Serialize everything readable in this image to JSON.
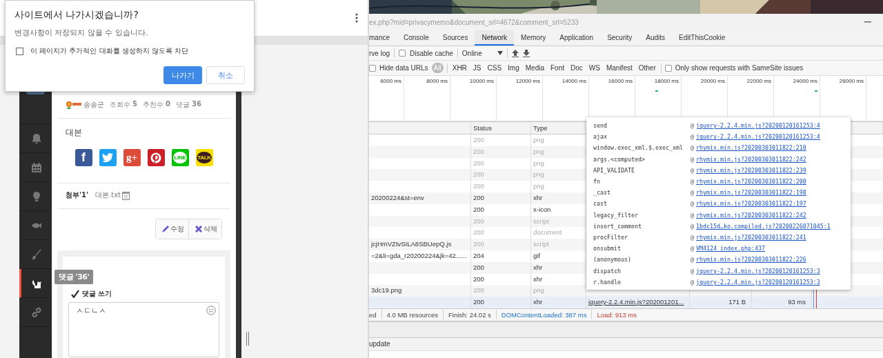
{
  "dialog": {
    "title": "사이트에서 나가시겠습니까?",
    "message": "변경사항이 저장되지 않을 수 있습니다.",
    "checkbox": {
      "label": "이 페이지가 추가적인 대화를 생성하지 않도록 차단",
      "checked": false
    },
    "buttons": [
      {
        "label": "나가기",
        "kind": "primary"
      },
      {
        "label": "취소",
        "kind": "secondary"
      }
    ]
  },
  "sidebar": {
    "items": [
      {
        "kind": "bell",
        "selected": false
      },
      {
        "kind": "calendar",
        "selected": false
      },
      {
        "kind": "bulb",
        "selected": false
      },
      {
        "kind": "fish",
        "selected": false
      },
      {
        "kind": "brush",
        "selected": false
      },
      {
        "kind": "cat",
        "selected": true
      },
      {
        "kind": "link",
        "selected": false
      }
    ],
    "tooltip": "댓글 '36'"
  },
  "post": {
    "author": "송송군",
    "stats": [
      {
        "label": "조회수",
        "value": "5"
      },
      {
        "label": "추천수",
        "value": "0"
      },
      {
        "label": "댓글",
        "value": "36"
      }
    ],
    "section_title": "대본",
    "share_buttons": [
      {
        "kind": "facebook",
        "label": "f"
      },
      {
        "kind": "twitter"
      },
      {
        "kind": "googleplus",
        "label": "g+"
      },
      {
        "kind": "pinterest"
      },
      {
        "kind": "line",
        "label": "LINE"
      },
      {
        "kind": "kakaotalk",
        "label": "TALK"
      }
    ],
    "attachments": {
      "label": "첨부'1'",
      "files": [
        "대본.txt"
      ]
    },
    "actions": [
      {
        "kind": "edit",
        "label": "수정"
      },
      {
        "kind": "delete",
        "label": "삭제"
      }
    ],
    "comment_form": {
      "title": "댓글 쓰기",
      "value": "ㅅㄷㄴㅅ"
    }
  },
  "devtools": {
    "url": "ex.php?mid=privacymemo&document_srl=4672&comment_srl=5233",
    "tabs": [
      {
        "label": "mance",
        "selected": false
      },
      {
        "label": "Console",
        "selected": false
      },
      {
        "label": "Sources",
        "selected": false
      },
      {
        "label": "Network",
        "selected": true
      },
      {
        "label": "Memory",
        "selected": false
      },
      {
        "label": "Application",
        "selected": false
      },
      {
        "label": "Security",
        "selected": false
      },
      {
        "label": "Audits",
        "selected": false
      },
      {
        "label": "EditThisCookie",
        "selected": false
      }
    ],
    "toolbar": {
      "preserve_log": "rve log",
      "disable_cache": {
        "label": "Disable cache",
        "checked": false
      },
      "throttling": "Online"
    },
    "filters": {
      "hide_data_urls": {
        "label": "Hide data URLs",
        "checked": false
      },
      "types": [
        {
          "label": "All",
          "selected": true
        },
        {
          "label": "XHR",
          "selected": false
        },
        {
          "label": "JS",
          "selected": false
        },
        {
          "label": "CSS",
          "selected": false
        },
        {
          "label": "Img",
          "selected": false
        },
        {
          "label": "Media",
          "selected": false
        },
        {
          "label": "Font",
          "selected": false
        },
        {
          "label": "Doc",
          "selected": false
        },
        {
          "label": "WS",
          "selected": false
        },
        {
          "label": "Manifest",
          "selected": false
        },
        {
          "label": "Other",
          "selected": false
        }
      ],
      "samesite": {
        "label": "Only show requests with SameSite issues",
        "checked": false
      }
    },
    "timeline": [
      {
        "label": "6000 ms",
        "bar": false
      },
      {
        "label": "8000 ms",
        "bar": false
      },
      {
        "label": "10000 ms",
        "bar": false
      },
      {
        "label": "12000 ms",
        "bar": false
      },
      {
        "label": "14000 ms",
        "bar": false
      },
      {
        "label": "16000 ms",
        "bar": false
      },
      {
        "label": "18000 ms",
        "bar": true
      },
      {
        "label": "20000 ms",
        "bar": false
      },
      {
        "label": "22000 ms",
        "bar": false
      },
      {
        "label": "24000 ms",
        "bar": true
      },
      {
        "label": "26000 ms",
        "bar": false
      }
    ],
    "table": {
      "columns": [
        "Status",
        "Type"
      ],
      "rows": [
        {
          "name": "",
          "status": "200",
          "type": "png",
          "dimmed": true
        },
        {
          "name": "",
          "status": "200",
          "type": "png",
          "dimmed": true
        },
        {
          "name": "",
          "status": "200",
          "type": "png",
          "dimmed": true
        },
        {
          "name": "",
          "status": "200",
          "type": "png",
          "dimmed": true
        },
        {
          "name": "",
          "status": "200",
          "type": "png",
          "dimmed": true
        },
        {
          "name": "20200224&st=env",
          "status": "200",
          "type": "xhr",
          "dimmed": false
        },
        {
          "name": "",
          "status": "200",
          "type": "x-icon",
          "dimmed": false
        },
        {
          "name": "",
          "status": "200",
          "type": "script",
          "dimmed": true
        },
        {
          "name": "",
          "status": "200",
          "type": "document",
          "dimmed": true
        },
        {
          "name": "jcjHmVZtvSILA8SBUepQ.js",
          "status": "200",
          "type": "script",
          "dimmed": true
        },
        {
          "name": "=2&li=gda_r20200224&jk=42......",
          "status": "204",
          "type": "gif",
          "dimmed": false
        },
        {
          "name": "",
          "status": "200",
          "type": "xhr",
          "dimmed": false
        },
        {
          "name": "",
          "status": "200",
          "type": "xhr",
          "dimmed": false
        },
        {
          "name": "3dc19.png",
          "status": "200",
          "type": "png",
          "dimmed": true
        },
        {
          "name": "",
          "status": "200",
          "type": "xhr",
          "dimmed": false,
          "selected": true,
          "initiator": "jquery-2.2.4.min.js?202001201...",
          "size": "171 B",
          "time": "93 ms"
        }
      ]
    },
    "summary": [
      {
        "text": "ed",
        "kind": "plain"
      },
      {
        "text": "4.0 MB resources",
        "kind": "plain"
      },
      {
        "text": "Finish: 24.02 s",
        "kind": "plain"
      },
      {
        "text": "DOMContentLoaded: 387 ms",
        "kind": "dom"
      },
      {
        "text": "Load: 913 ms",
        "kind": "load"
      }
    ],
    "drawer_item": "update",
    "call_stack": [
      {
        "function": "send",
        "at": "@",
        "source": "jquery-2.2.4.min.js?20200120161253:4"
      },
      {
        "function": "ajax",
        "at": "@",
        "source": "jquery-2.2.4.min.js?20200120161253:4"
      },
      {
        "function": "window.exec_xml.$.exec_xml",
        "at": "@",
        "source": "rhymix.min.js?20200303011822:210"
      },
      {
        "function": "args.<computed>",
        "at": "@",
        "source": "rhymix.min.js?20200303011822:242"
      },
      {
        "function": "API_VALIDATE",
        "at": "@",
        "source": "rhymix.min.js?20200303011822:239"
      },
      {
        "function": "fn",
        "at": "@",
        "source": "rhymix.min.js?20200303011822:200"
      },
      {
        "function": "_cast",
        "at": "@",
        "source": "rhymix.min.js?20200303011822:198"
      },
      {
        "function": "cast",
        "at": "@",
        "source": "rhymix.min.js?20200303011822:197"
      },
      {
        "function": "legacy_filter",
        "at": "@",
        "source": "rhymix.min.js?20200303011822:242"
      },
      {
        "function": "insert_comment",
        "at": "@",
        "source": "1bdc15d…ko.compiled.js?20200226071045:1"
      },
      {
        "function": "procFilter",
        "at": "@",
        "source": "rhymix.min.js?20200303011822:241"
      },
      {
        "function": "onsubmit",
        "at": "@",
        "source": "VM4124 index.php:437"
      },
      {
        "function": "(anonymous)",
        "at": "@",
        "source": "rhymix.min.js?20200303011822:226"
      },
      {
        "function": "dispatch",
        "at": "@",
        "source": "jquery-2.2.4.min.js?20200120161253:3"
      },
      {
        "function": "r.handle",
        "at": "@",
        "source": "jquery-2.2.4.min.js?20200120161253:3"
      }
    ]
  }
}
